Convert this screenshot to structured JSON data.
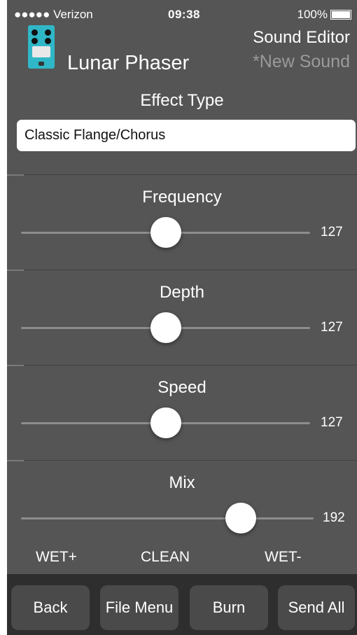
{
  "status_bar": {
    "carrier": "●●●●● Verizon",
    "time": "09:38",
    "battery": "100%"
  },
  "header": {
    "app_title": "Lunar Phaser",
    "editor_label": "Sound Editor",
    "sound_name": "*New Sound"
  },
  "effect": {
    "label": "Effect Type",
    "value": "Classic Flange/Chorus"
  },
  "sliders": [
    {
      "label": "Frequency",
      "value": "127",
      "position": 0.5
    },
    {
      "label": "Depth",
      "value": "127",
      "position": 0.5
    },
    {
      "label": "Speed",
      "value": "127",
      "position": 0.5
    },
    {
      "label": "Mix",
      "value": "192",
      "position": 0.75
    }
  ],
  "mix_labels": [
    "WET+",
    "CLEAN",
    "WET-"
  ],
  "toolbar": {
    "back": "Back",
    "file_menu": "File Menu",
    "burn": "Burn",
    "send_all": "Send All"
  },
  "colors": {
    "background": "#555555",
    "toolbar": "#2e2e2e",
    "pedal": "#2fb7c7"
  }
}
